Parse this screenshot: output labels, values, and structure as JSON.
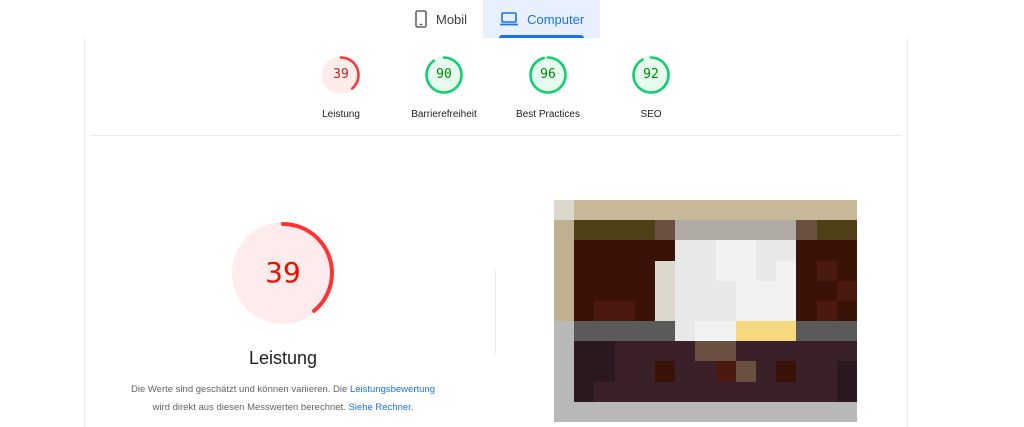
{
  "tabs": [
    {
      "label": "Mobil",
      "icon": "phone-icon",
      "active": false
    },
    {
      "label": "Computer",
      "icon": "laptop-icon",
      "active": true
    }
  ],
  "gauges": [
    {
      "score": "39",
      "value": 39,
      "label": "Leistung",
      "status": "fail"
    },
    {
      "score": "90",
      "value": 90,
      "label": "Barrierefreiheit",
      "status": "pass"
    },
    {
      "score": "96",
      "value": 96,
      "label": "Best Practices",
      "status": "pass"
    },
    {
      "score": "92",
      "value": 92,
      "label": "SEO",
      "status": "pass"
    }
  ],
  "colors": {
    "fail": "#ff3333",
    "fail_text": "#c5221f",
    "fail_bg": "#fdeceb",
    "pass": "#0cce6b",
    "pass_text": "#008800",
    "pass_bg": "#e6faf0",
    "accent": "#1a73e8"
  },
  "performance": {
    "score": "39",
    "value": 39,
    "title": "Leistung",
    "desc_part1": "Die Werte sind geschätzt und können variieren. Die ",
    "link_scoring": "Leistungsbewertung",
    "desc_part2": "wird direkt aus diesen Messwerten berechnet. ",
    "link_calculator": "Siehe Rechner",
    "desc_end": "."
  },
  "screenshot_thumbnail": {
    "palette": [
      "#dcd8cc",
      "#c8b89a",
      "#504018",
      "#3a1208",
      "#4a1a10",
      "#e8e8e8",
      "#f2f2f2",
      "#b0aaa4",
      "#5a5a5a",
      "#f5d880",
      "#3a2028",
      "#2a1820",
      "#b8b8b8",
      "#c0b090",
      "#6a5040"
    ]
  }
}
